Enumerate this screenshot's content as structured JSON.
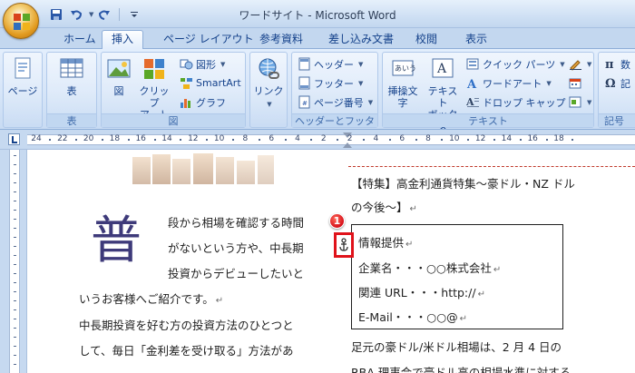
{
  "window": {
    "title": "ワードサイト - Microsoft Word"
  },
  "qat": {
    "icons": [
      "save-icon",
      "undo-icon",
      "redo-icon",
      "customize-icon"
    ]
  },
  "tabs": [
    {
      "label": "ホーム",
      "active": false
    },
    {
      "label": "挿入",
      "active": true
    },
    {
      "label": "ページ レイアウト",
      "active": false
    },
    {
      "label": "参考資料",
      "active": false
    },
    {
      "label": "差し込み文書",
      "active": false
    },
    {
      "label": "校閲",
      "active": false
    },
    {
      "label": "表示",
      "active": false
    }
  ],
  "ribbon": {
    "pages": {
      "label": "ページ"
    },
    "table": {
      "button": "表",
      "group": "表"
    },
    "illustrations": {
      "group": "図",
      "picture": "図",
      "clipart_line1": "クリップ",
      "clipart_line2": "アート",
      "shapes": "図形",
      "smartart": "SmartArt",
      "chart": "グラフ"
    },
    "links": {
      "label": "リンク"
    },
    "headerfooter": {
      "group": "ヘッダーとフッター",
      "header": "ヘッダー",
      "footer": "フッター",
      "pagenumber": "ページ番号"
    },
    "text": {
      "group": "テキスト",
      "insert_text_line1": "挿操文",
      "insert_text_line2": "字",
      "textbox_line1": "テキスト",
      "textbox_line2": "ボックス",
      "quickparts": "クイック パーツ",
      "wordart": "ワードアート",
      "dropcap": "ドロップ キャップ"
    },
    "symbols": {
      "equation": "数",
      "symbol": "記",
      "group": "記号"
    }
  },
  "ruler": {
    "numbers": [
      "24",
      "22",
      "20",
      "18",
      "16",
      "14",
      "12",
      "10",
      "8",
      "6",
      "4",
      "2",
      "2",
      "4",
      "6",
      "8",
      "10",
      "12",
      "14",
      "16",
      "18"
    ]
  },
  "document": {
    "dropcap": "普",
    "left_lines": [
      "段から相場を確認する時間",
      "がないという方や、中長期",
      "投資からデビューしたいと",
      "いうお客様へご紹介です。",
      "中長期投資を好む方の投資方法のひとつと",
      "して、毎日「金利差を受け取る」方法があ"
    ],
    "heading_line1": "【特集】高金利通貨特集～豪ドル・NZ ドル",
    "heading_line2": "の今後～】",
    "box_lines": [
      "情報提供",
      "企業名・・・○○株式会社",
      "関連 URL・・・http://",
      "E-Mail・・・○○@"
    ],
    "body_line1": "足元の豪ドル/米ドル相場は、2 月 4 日の",
    "body_line2": "RBA 理事会で豪ドル高の相場水準に対する",
    "callout_number": "1"
  }
}
